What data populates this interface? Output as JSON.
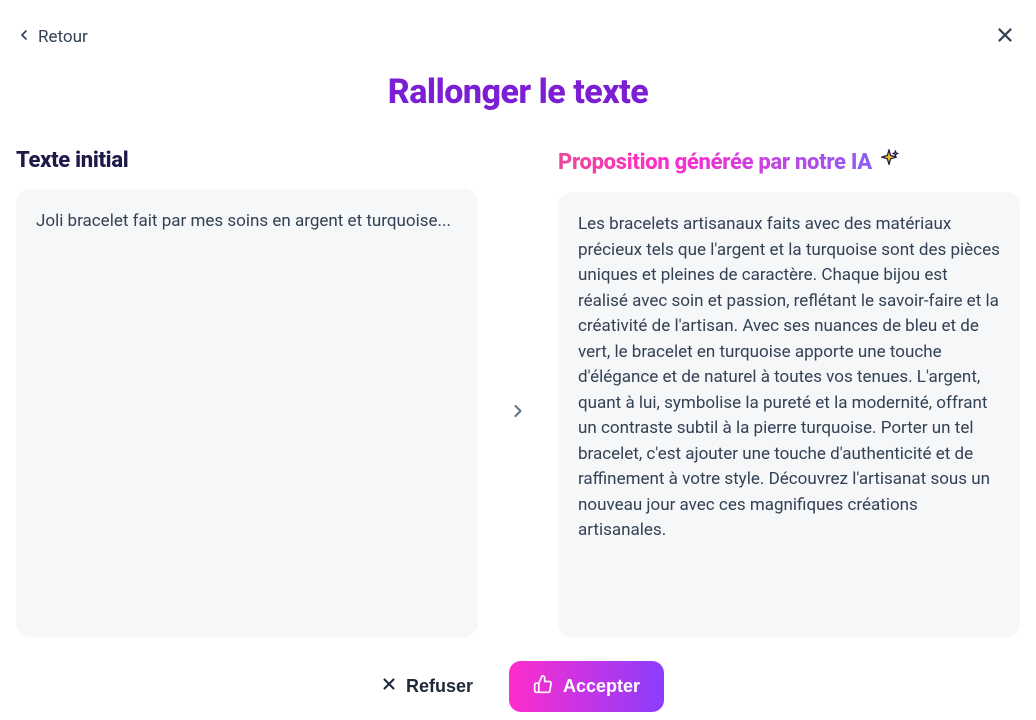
{
  "header": {
    "back_label": "Retour"
  },
  "page_title": "Rallonger le texte",
  "left": {
    "heading": "Texte initial",
    "body": "Joli bracelet fait par mes soins en argent et turquoise..."
  },
  "right": {
    "heading": "Proposition générée par notre IA",
    "body": "Les bracelets artisanaux faits avec des matériaux précieux tels que l'argent et la turquoise sont des pièces uniques et pleines de caractère. Chaque bijou est réalisé avec soin et passion, reflétant le savoir-faire et la créativité de l'artisan. Avec ses nuances de bleu et de vert, le bracelet en turquoise apporte une touche d'élégance et de naturel à toutes vos tenues. L'argent, quant à lui, symbolise la pureté et la modernité, offrant un contraste subtil à la pierre turquoise. Porter un tel bracelet, c'est ajouter une touche d'authenticité et de raffinement à votre style. Découvrez l'artisanat sous un nouveau jour avec ces magnifiques créations artisanales."
  },
  "footer": {
    "reject_label": "Refuser",
    "accept_label": "Accepter"
  },
  "icons": {
    "back": "chevron-left-icon",
    "close": "close-icon",
    "sparkle": "sparkle-icon",
    "divider": "chevron-right-icon",
    "reject": "x-icon",
    "accept": "thumbs-up-icon"
  },
  "colors": {
    "title": "#7c1fd4",
    "heading_dark": "#1e1b4b",
    "gradient_start": "#ff2dcb",
    "gradient_end": "#8b3dff",
    "panel_bg": "#f6f7f9",
    "body_text": "#334155"
  }
}
